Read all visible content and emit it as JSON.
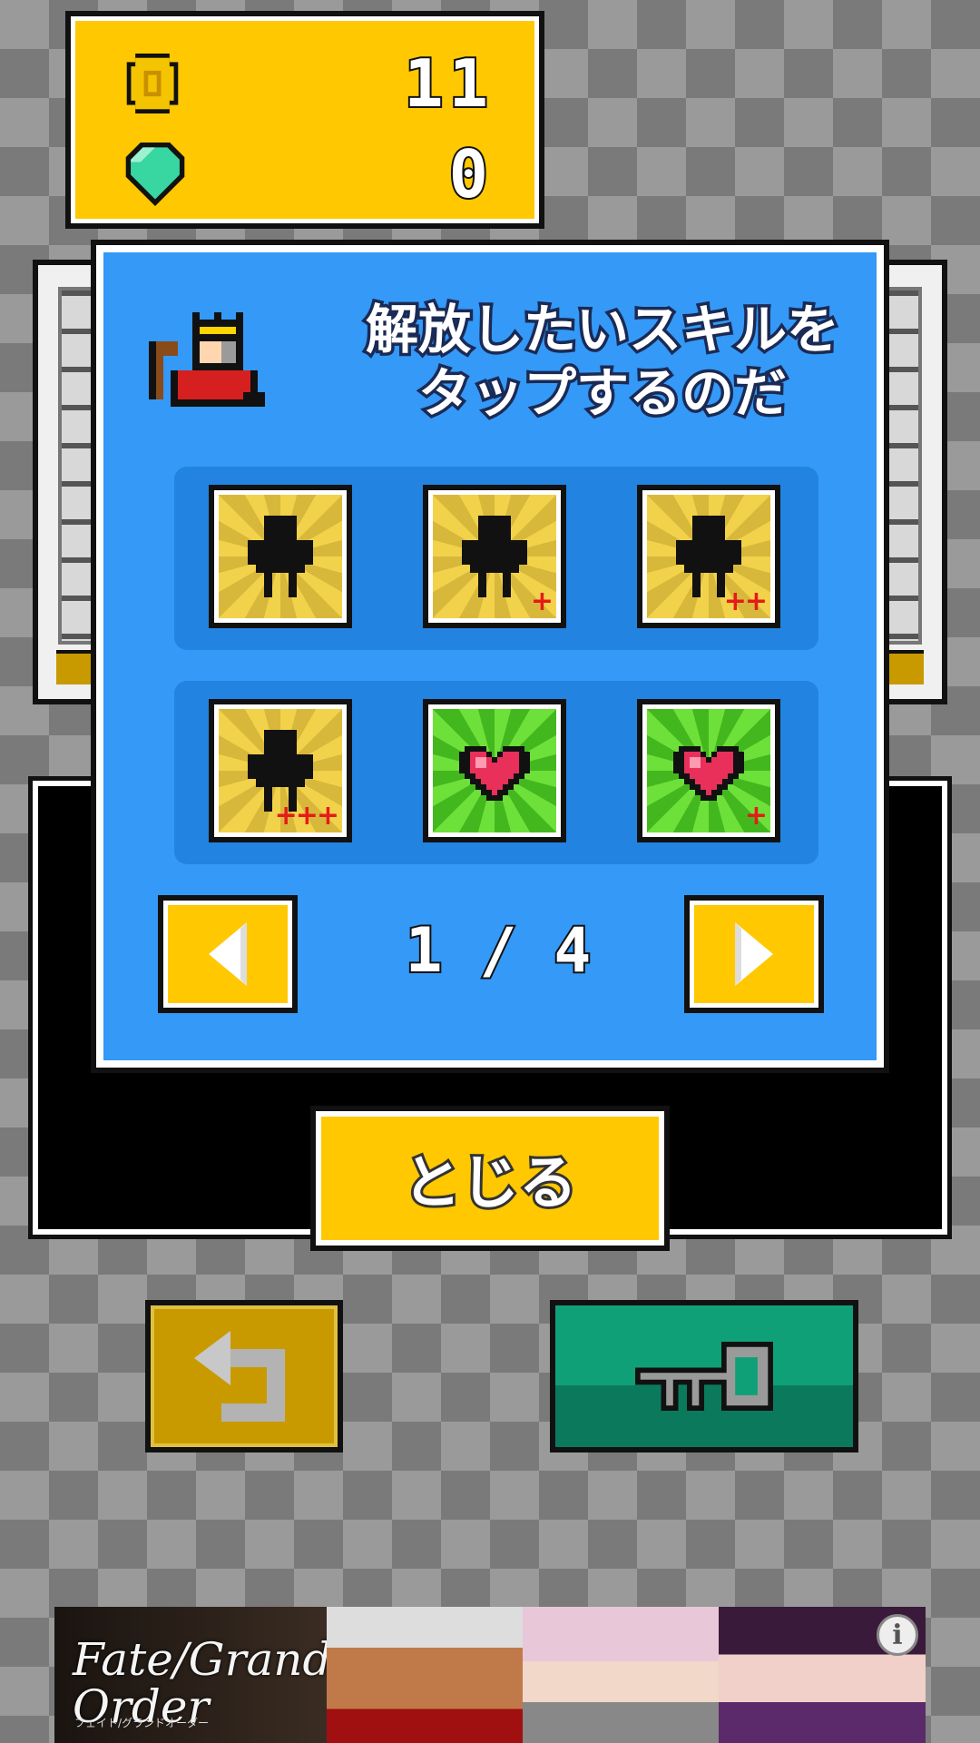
{
  "currency": {
    "coins": {
      "icon": "coin-icon",
      "value": "11"
    },
    "gems": {
      "icon": "gem-icon",
      "value": "0"
    }
  },
  "dialog": {
    "title": "解放したいスキルを\nタップするのだ",
    "character_icon": "king-icon",
    "skills": [
      {
        "row": 1,
        "icon": "stickman-icon",
        "tile": "yellow",
        "plus": ""
      },
      {
        "row": 1,
        "icon": "stickman-icon",
        "tile": "yellow",
        "plus": "+"
      },
      {
        "row": 1,
        "icon": "stickman-icon",
        "tile": "yellow",
        "plus": "++"
      },
      {
        "row": 2,
        "icon": "stickman-icon",
        "tile": "yellow",
        "plus": "+++"
      },
      {
        "row": 2,
        "icon": "heart-icon",
        "tile": "green",
        "plus": ""
      },
      {
        "row": 2,
        "icon": "heart-icon",
        "tile": "green",
        "plus": "+"
      }
    ],
    "page_indicator": "1 / 4",
    "prev_icon": "arrow-left-icon",
    "next_icon": "arrow-right-icon"
  },
  "close_button": {
    "label": "とじる"
  },
  "bottom_buttons": {
    "back_icon": "return-arrow-icon",
    "key_icon": "key-icon"
  },
  "ad": {
    "logo": "Fate/Grand Order",
    "subtitle": "フェイト/グランドオーダー",
    "info_icon": "info-icon"
  },
  "colors": {
    "yellow": "#ffc800",
    "dialog_blue": "#3499f7",
    "green_button": "#10a078",
    "plus_red": "#e51a1a"
  }
}
